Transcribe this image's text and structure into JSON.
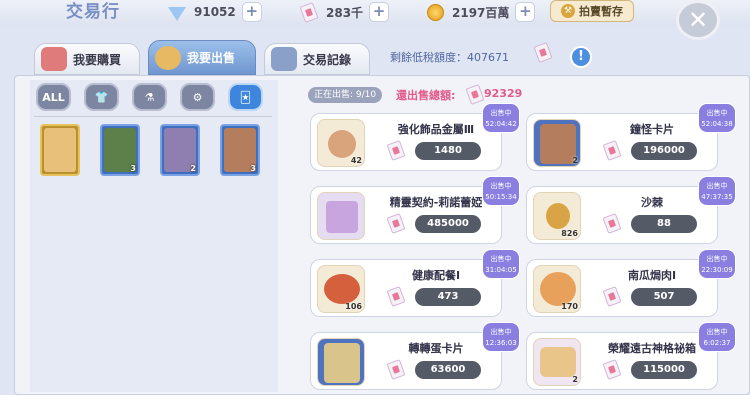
{
  "header": {
    "title": "交易行",
    "gems": "91052",
    "tickets": "283千",
    "zeny": "2197百萬",
    "auction_label": "拍賣暫存",
    "close": "✕"
  },
  "tabs": [
    {
      "label": "我要購買"
    },
    {
      "label": "我要出售"
    },
    {
      "label": "交易記錄"
    }
  ],
  "tax": {
    "label": "剩餘低稅額度：407671"
  },
  "categories": [
    {
      "label": "ALL"
    },
    {
      "label": "👕"
    },
    {
      "label": "⚗"
    },
    {
      "label": "⚙"
    },
    {
      "label": "🃏"
    }
  ],
  "inventory": [
    {
      "count": ""
    },
    {
      "count": "3"
    },
    {
      "count": "2"
    },
    {
      "count": "3"
    }
  ],
  "sale": {
    "on_sale": "正在出售: 9/10",
    "total_label": "還出售總額:",
    "total_value": "92329"
  },
  "listings": [
    {
      "name": "強化飾品金屬Ⅲ",
      "qty": "42",
      "price": "1480",
      "timer": ""
    },
    {
      "name": "鐘怪卡片",
      "qty": "2",
      "price": "196000",
      "timer": "出售中\n52:04:38"
    },
    {
      "name": "精靈契約-莉諾蕾婭",
      "qty": "",
      "price": "485000",
      "timer": "出售中\n50:15:34"
    },
    {
      "name": "沙棘",
      "qty": "826",
      "price": "88",
      "timer": "出售中\n47:37:35"
    },
    {
      "name": "健康配餐Ⅰ",
      "qty": "106",
      "price": "473",
      "timer": "出售中\n31:04:05"
    },
    {
      "name": "南瓜焗肉Ⅰ",
      "qty": "170",
      "price": "507",
      "timer": "出售中\n22:30:09"
    },
    {
      "name": "轉轉蛋卡片",
      "qty": "",
      "price": "63600",
      "timer": "出售中\n12:36:03"
    },
    {
      "name": "榮耀遠古神格祕箱",
      "qty": "2",
      "price": "115000",
      "timer": "出售中\n6:02:37"
    }
  ],
  "timer_first": "出售中\n52:04:42"
}
